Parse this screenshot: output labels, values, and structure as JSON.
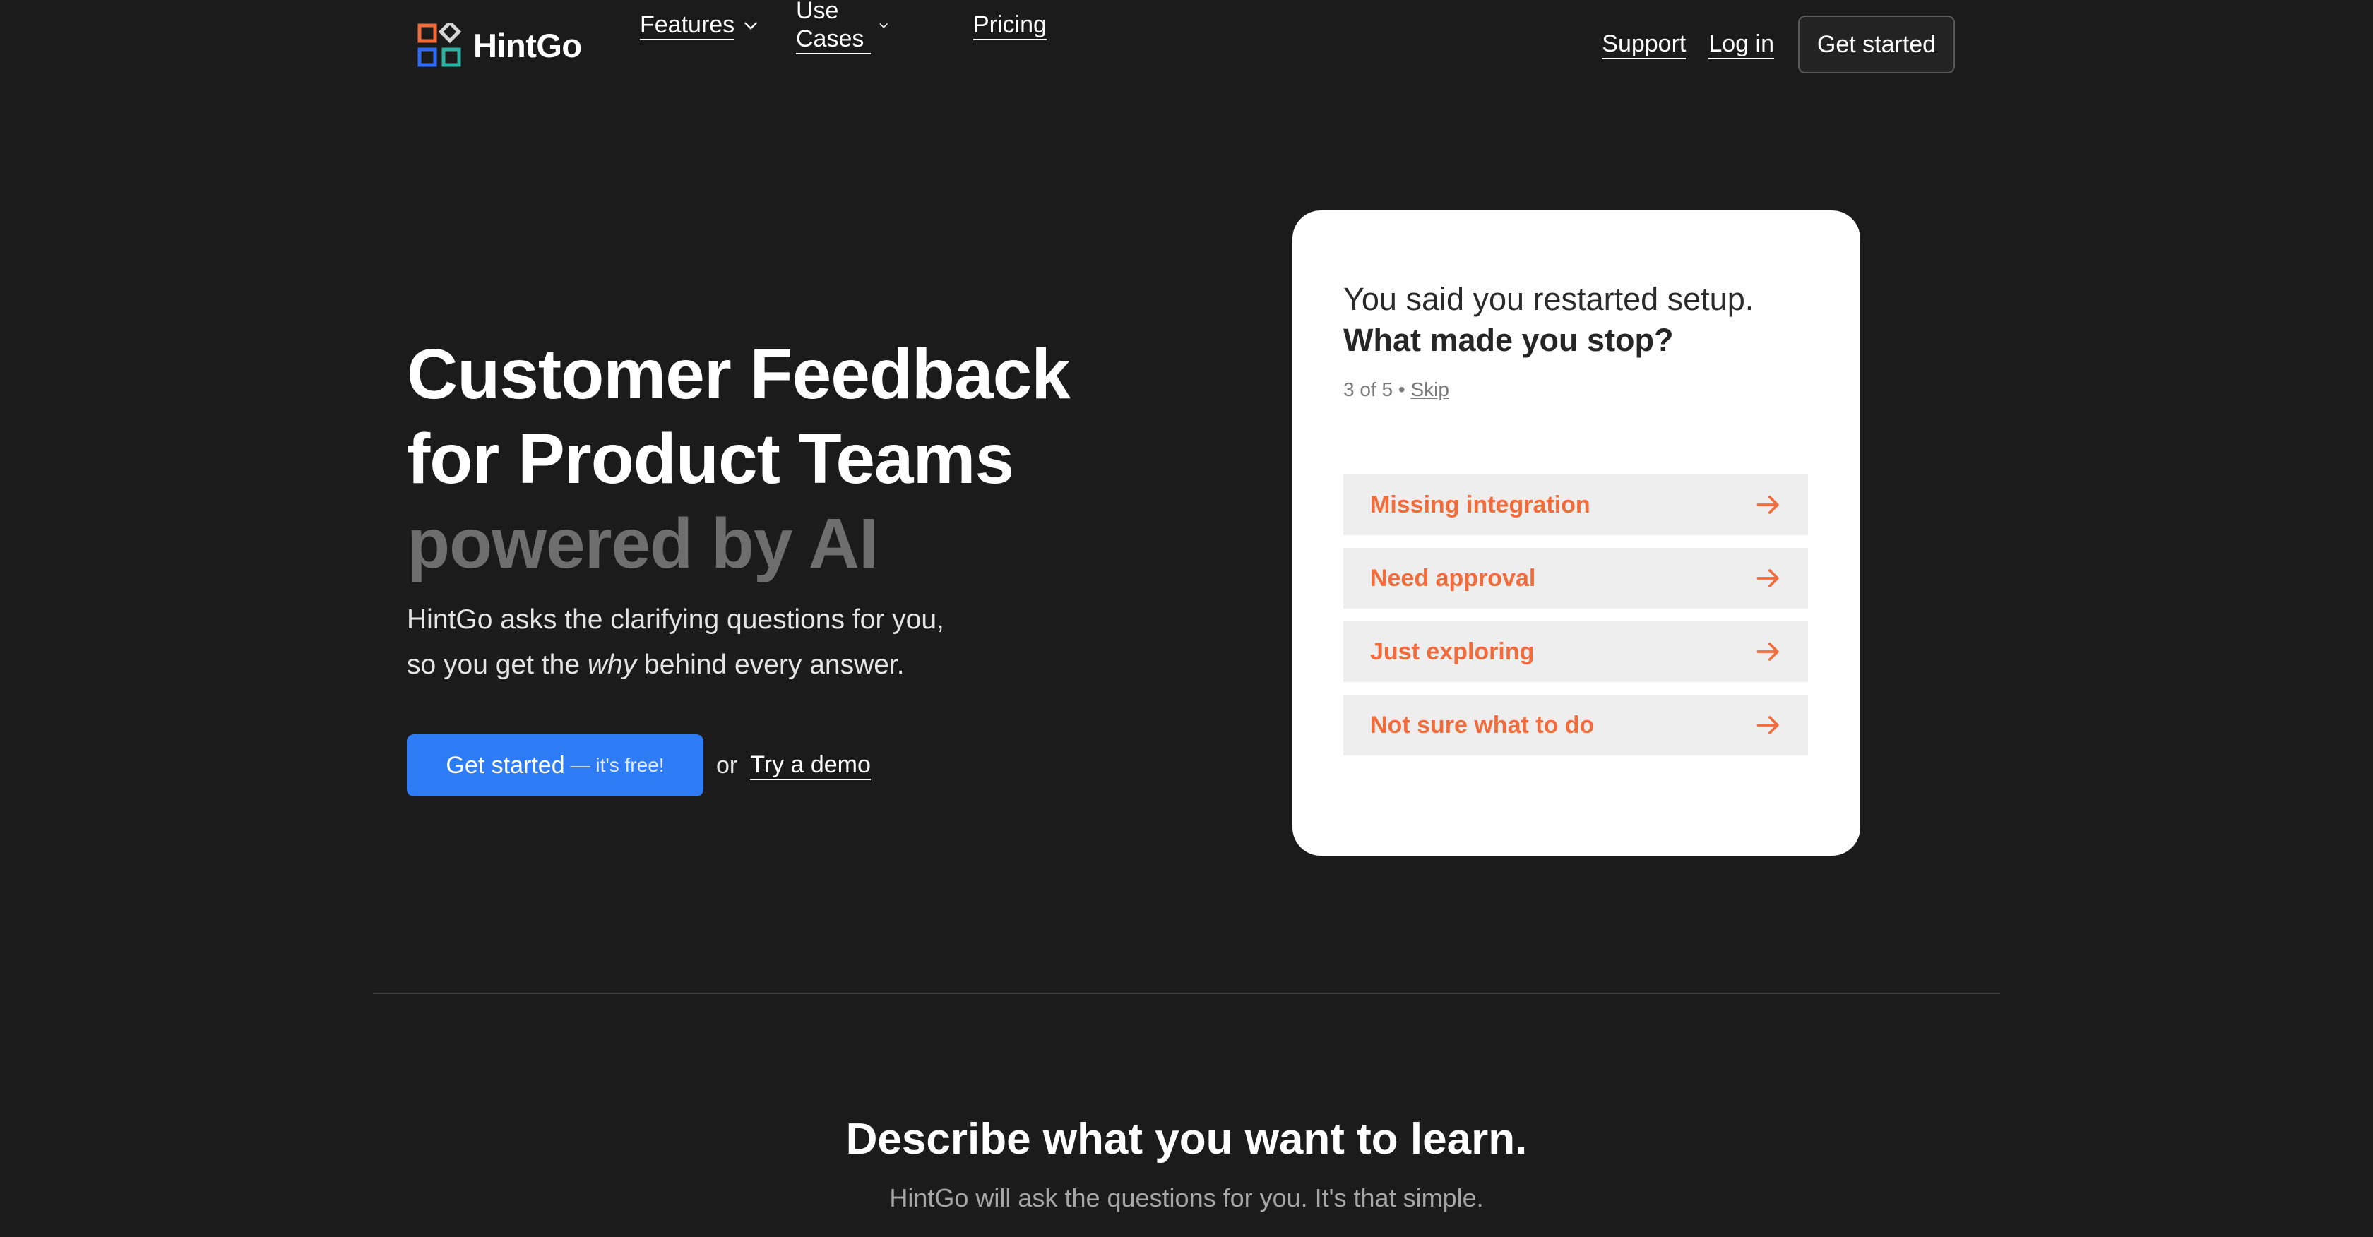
{
  "header": {
    "brand": "HintGo",
    "nav": [
      {
        "label": "Features",
        "has_dropdown": true
      },
      {
        "label": "Use Cases",
        "has_dropdown": true
      },
      {
        "label": "Pricing",
        "has_dropdown": false
      }
    ],
    "support": "Support",
    "login": "Log in",
    "get_started": "Get started"
  },
  "hero": {
    "title_line1": "Customer Feedback",
    "title_line2": "for Product Teams",
    "title_line3": "powered by AI",
    "sub_line1": "HintGo asks the clarifying questions for you,",
    "sub_line2_pre": "so you get the ",
    "sub_line2_em": "why",
    "sub_line2_post": " behind every answer.",
    "cta_label": "Get started",
    "cta_free": "— it's free!",
    "or_text": "or",
    "demo_link": "Try a demo"
  },
  "card": {
    "question_line1": "You said you restarted setup.",
    "question_line2": "What made you stop?",
    "progress": "3 of 5",
    "separator": "•",
    "skip": "Skip",
    "options": [
      "Missing integration",
      "Need approval",
      "Just exploring",
      "Not sure what to do"
    ]
  },
  "section": {
    "title": "Describe what you want to learn.",
    "subtitle": "HintGo will ask the questions for you. It's that simple."
  },
  "colors": {
    "background": "#1b1b1b",
    "primary": "#2e7bf6",
    "option_text": "#f26b3a",
    "logo_orange": "#f26b3a",
    "logo_gray": "#d6d6d6",
    "logo_blue": "#2e6bf6",
    "logo_teal": "#2bb3a3"
  }
}
